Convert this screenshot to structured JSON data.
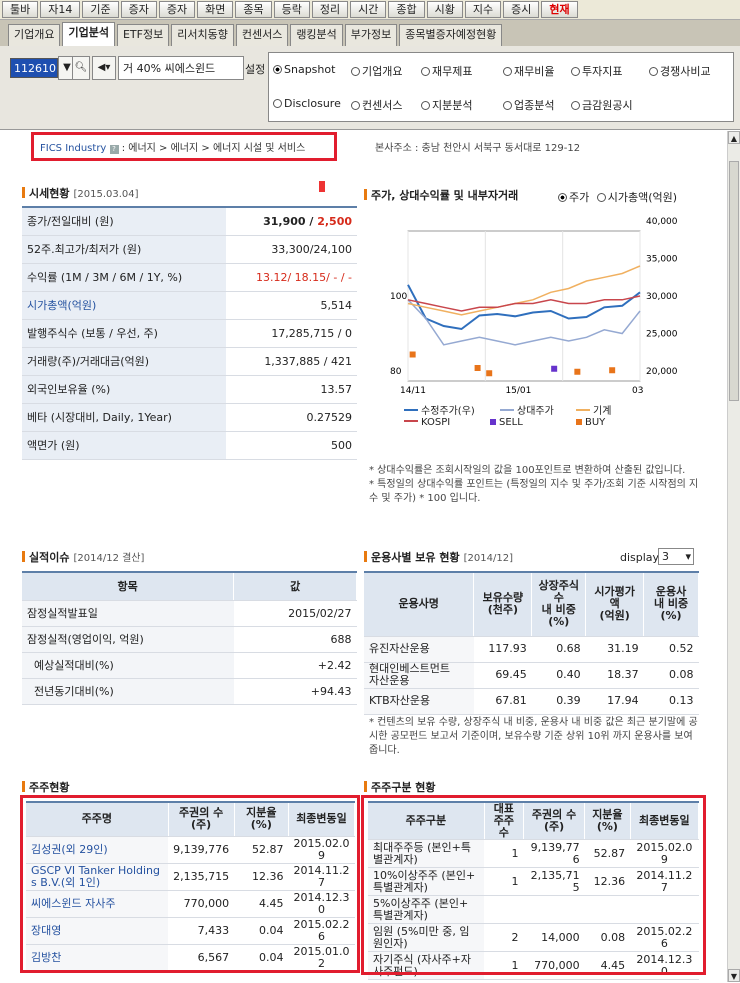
{
  "toolbar": [
    "툴바",
    "자14",
    "기준",
    "증자",
    "증자",
    "화면",
    "종목",
    "등락",
    "정리",
    "시간",
    "종합",
    "시황",
    "지수",
    "증시",
    "현재"
  ],
  "tabs": [
    "기업개요",
    "기업분석",
    "ETF정보",
    "리서치동향",
    "컨센서스",
    "랭킹분석",
    "부가정보",
    "종목별증자예정현황"
  ],
  "control": {
    "code": "112610",
    "market": "거 40%",
    "company": "씨에스윈드",
    "settings_label": "설정"
  },
  "radios": [
    {
      "label": "Snapshot",
      "on": true
    },
    {
      "label": "기업개요",
      "on": false
    },
    {
      "label": "재무제표",
      "on": false
    },
    {
      "label": "재무비율",
      "on": false
    },
    {
      "label": "투자지표",
      "on": false
    },
    {
      "label": "경쟁사비교",
      "on": false
    },
    {
      "label": "Disclosure",
      "on": false
    },
    {
      "label": "컨센서스",
      "on": false
    },
    {
      "label": "지분분석",
      "on": false
    },
    {
      "label": "업종분석",
      "on": false
    },
    {
      "label": "금감원공시",
      "on": false
    }
  ],
  "fics": {
    "label": "FICS Industry",
    "path": "에너지 > 에너지 > 에너지 시설 및 서비스"
  },
  "address": {
    "label": "본사주소 :",
    "value": "충남 천안시 서북구 동서대로 129-12"
  },
  "market": {
    "title": "시세현황",
    "date": "[2015.03.04]",
    "rows": [
      {
        "k": "종가/전일대비 (원)",
        "v": "31,900 / ",
        "v2": "2,500"
      },
      {
        "k": "52주.최고가/최저가 (원)",
        "v": "33,300/24,100"
      },
      {
        "k": "수익률 (1M / 3M / 6M / 1Y, %)",
        "v": "13.12/ 18.15/ - / -"
      },
      {
        "k": "시가총액(억원)",
        "v": "5,514"
      },
      {
        "k": "발행주식수 (보통 / 우선, 주)",
        "v": "17,285,715 / 0"
      },
      {
        "k": "거래량(주)/거래대금(억원)",
        "v": "1,337,885 / 421"
      },
      {
        "k": "외국인보유율 (%)",
        "v": "13.57"
      },
      {
        "k": "베타 (시장대비, Daily, 1Year)",
        "v": "0.27529"
      },
      {
        "k": "액면가 (원)",
        "v": "500"
      }
    ]
  },
  "chart": {
    "title": "주가, 상대수익률 및 내부자거래",
    "radio1": "주가",
    "radio2": "시가총액(억원)",
    "notes": [
      "* 상대수익률은 조회시작일의 값을 100포인트로 변환하여 산출된 값입니다.",
      "* 특정일의 상대수익률 포인트는 (특정일의 지수 및 주가/조회 기준 시작점의 지수 및 주가) * 100 입니다."
    ],
    "legend": [
      "수정주가(우)",
      "상대주가",
      "기계",
      "KOSPI",
      "SELL",
      "BUY"
    ]
  },
  "chart_data": {
    "type": "line",
    "x": [
      "14/11",
      "15/01",
      "03"
    ],
    "ylim_left": [
      80,
      100
    ],
    "ylim_right": [
      20000,
      40000
    ],
    "left_ticks": [
      "100",
      "80"
    ],
    "right_ticks": [
      "40,000",
      "35,000",
      "30,000",
      "25,000",
      "20,000"
    ],
    "series": [
      {
        "name": "수정주가(우)",
        "color": "#2f6fbd",
        "values": [
          31500,
          27000,
          26000,
          25600,
          27400,
          27600,
          27300,
          27800,
          28000,
          27000,
          27200,
          28500,
          28700,
          30500
        ]
      },
      {
        "name": "상대주가",
        "color": "#95a9d2",
        "values": [
          99,
          94,
          87,
          88,
          89,
          88,
          87,
          88,
          89,
          88,
          89,
          91,
          90,
          96
        ]
      },
      {
        "name": "기계",
        "color": "#f0b060",
        "values": [
          98,
          97,
          96,
          95,
          96,
          97,
          98,
          99,
          101,
          102,
          104,
          105,
          106,
          108
        ]
      },
      {
        "name": "KOSPI",
        "color": "#c8464c",
        "values": [
          99,
          98,
          97,
          96,
          97,
          97,
          98,
          98,
          99,
          98,
          98,
          99,
          99,
          100
        ]
      },
      {
        "name": "SELL",
        "color": "#6633cc",
        "points": [
          [
            0.63,
            20300
          ]
        ]
      },
      {
        "name": "BUY",
        "color": "#e8741a",
        "points": [
          [
            0.02,
            22200
          ],
          [
            0.3,
            20400
          ],
          [
            0.35,
            19700
          ],
          [
            0.73,
            19900
          ],
          [
            0.88,
            20100
          ]
        ]
      }
    ]
  },
  "perf": {
    "title": "실적이슈",
    "date": "[2014/12 결산]",
    "headers": [
      "항목",
      "값"
    ],
    "rows": [
      [
        "잠정실적발표일",
        "2015/02/27"
      ],
      [
        "잠정실적(영업이익, 억원)",
        "688"
      ],
      [
        "예상실적대비(%)",
        "+2.42"
      ],
      [
        "전년동기대비(%)",
        "+94.43"
      ]
    ]
  },
  "fund": {
    "title": "운용사별 보유 현황",
    "date": "[2014/12]",
    "display_label": "display",
    "display_value": "3",
    "headers": [
      "운용사명",
      "보유수량\n(천주)",
      "상장주식수\n내 비중\n(%)",
      "시가평가액\n(억원)",
      "운용사\n내 비중\n(%)"
    ],
    "rows": [
      [
        "유진자산운용",
        "117.93",
        "0.68",
        "31.19",
        "0.52"
      ],
      [
        "현대인베스트먼트\n자산운용",
        "69.45",
        "0.40",
        "18.37",
        "0.08"
      ],
      [
        "KTB자산운용",
        "67.81",
        "0.39",
        "17.94",
        "0.13"
      ]
    ],
    "note": "* 컨텐츠의 보유 수량, 상장주식 내 비중, 운용사 내 비중 값은 최근 분기말에 공시한 공모펀드 보고서 기준이며, 보유수량 기준 상위 10위 까지 운용사를 보여줍니다."
  },
  "holders": {
    "title": "주주현황",
    "headers": [
      "주주명",
      "주권의 수\n(주)",
      "지분율 (%)",
      "최종변동일"
    ],
    "rows": [
      [
        "김성권(외 29인)",
        "9,139,776",
        "52.87",
        "2015.02.0\n9"
      ],
      [
        "GSCP VI Tanker Holding\ns B.V.(외 1인)",
        "2,135,715",
        "12.36",
        "2014.11.2\n7"
      ],
      [
        "씨에스윈드 자사주",
        "770,000",
        "4.45",
        "2014.12.3\n0"
      ],
      [
        "장대영",
        "7,433",
        "0.04",
        "2015.02.2\n6"
      ],
      [
        "김방찬",
        "6,567",
        "0.04",
        "2015.01.0\n2"
      ]
    ]
  },
  "groups": {
    "title": "주주구분 현황",
    "headers": [
      "주주구분",
      "대표주주\n수",
      "주권의 수\n(주)",
      "지분율\n(%)",
      "최종변동일"
    ],
    "rows": [
      [
        "최대주주등 (본인+특\n별관계자)",
        "1",
        "9,139,77\n6",
        "52.87",
        "2015.02.0\n9"
      ],
      [
        "10%이상주주 (본인+\n특별관계자)",
        "1",
        "2,135,71\n5",
        "12.36",
        "2014.11.2\n7"
      ],
      [
        "5%이상주주 (본인+\n특별관계자)",
        "",
        "",
        "",
        ""
      ],
      [
        "임원 (5%미만 중, 임\n원인자)",
        "2",
        "14,000",
        "0.08",
        "2015.02.2\n6"
      ],
      [
        "자기주식 (자사주+자\n사주펀드)",
        "1",
        "770,000",
        "4.45",
        "2014.12.3\n0"
      ]
    ]
  }
}
